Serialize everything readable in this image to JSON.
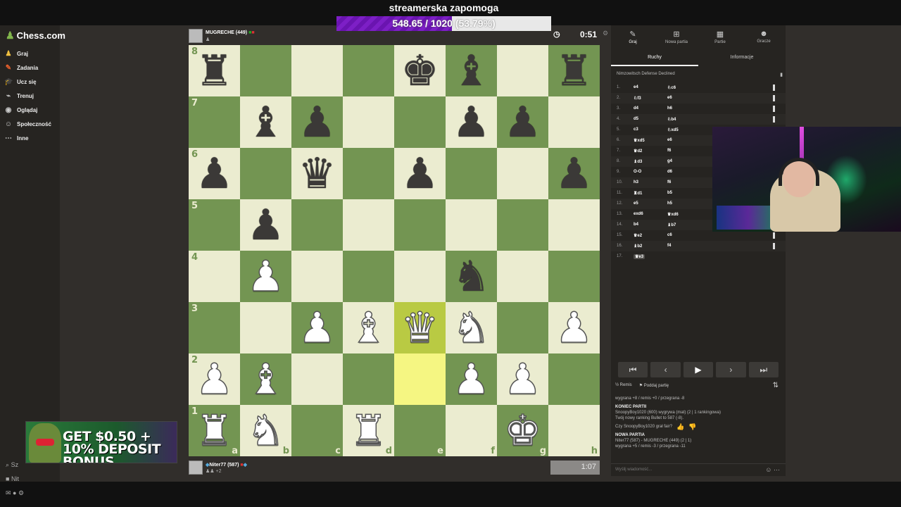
{
  "stream": {
    "title": "streamerska zapomoga",
    "progress_value": "548.65 / 1020",
    "progress_pct_label": "(53.79%)",
    "progress_fraction": 0.5379,
    "progress_color": "#7d1fc6"
  },
  "sidebar": {
    "logo": "Chess.com",
    "items": [
      {
        "label": "Graj",
        "icon": "pawn-play-icon",
        "color": "#f0c040"
      },
      {
        "label": "Zadania",
        "icon": "puzzle-icon",
        "color": "#e8602c"
      },
      {
        "label": "Ucz się",
        "icon": "learn-icon",
        "color": "#3ba0e0"
      },
      {
        "label": "Trenuj",
        "icon": "train-icon",
        "color": "#ccc"
      },
      {
        "label": "Oglądaj",
        "icon": "watch-icon",
        "color": "#ccc"
      },
      {
        "label": "Społeczność",
        "icon": "community-icon",
        "color": "#ccc"
      },
      {
        "label": "Inne",
        "icon": "more-icon",
        "color": "#ccc"
      }
    ],
    "bonus_text": "GET $0.50 + 10% DEPOSIT BONUS",
    "search_prefix": "Sz",
    "user_prefix": "Nit"
  },
  "top_player": {
    "name": "MUGRECHE",
    "rating": "(449)",
    "clock": "0:51"
  },
  "bottom_player": {
    "name": "Niter77",
    "rating": "(587)",
    "diff": "+2",
    "clock": "1:07"
  },
  "board": {
    "rows": [
      [
        "br",
        "",
        "",
        "",
        "bk",
        "bb",
        "",
        "br"
      ],
      [
        "",
        "bb",
        "bp",
        "",
        "",
        "bp",
        "bp",
        ""
      ],
      [
        "bp",
        "",
        "bq",
        "",
        "bp",
        "",
        "",
        "bp"
      ],
      [
        "",
        "bp",
        "",
        "",
        "",
        "",
        "",
        ""
      ],
      [
        "",
        "wp",
        "",
        "",
        "",
        "bn",
        "",
        ""
      ],
      [
        "",
        "",
        "wp",
        "wb",
        "wq",
        "wn",
        "",
        "wp"
      ],
      [
        "wp",
        "wb",
        "",
        "",
        "",
        "wp",
        "wp",
        ""
      ],
      [
        "wr",
        "wn",
        "",
        "wr",
        "",
        "",
        "wk",
        ""
      ]
    ],
    "highlights": [
      "e3",
      "e2"
    ],
    "ranks": [
      "8",
      "7",
      "6",
      "5",
      "4",
      "3",
      "2",
      "1"
    ],
    "files": [
      "a",
      "b",
      "c",
      "d",
      "e",
      "f",
      "g",
      "h"
    ]
  },
  "panel": {
    "tabs": [
      {
        "label": "Graj",
        "icon": "pawn-icon"
      },
      {
        "label": "Nowa partia",
        "icon": "plus-icon"
      },
      {
        "label": "Partie",
        "icon": "board-icon"
      },
      {
        "label": "Gracze",
        "icon": "players-icon"
      }
    ],
    "subtabs": [
      "Ruchy",
      "Informacje"
    ],
    "opening": "Nimzowitsch Defense Declined",
    "moves": [
      {
        "n": "1.",
        "w": "e4",
        "b": "♘c6"
      },
      {
        "n": "2.",
        "w": "♘f3",
        "b": "e6"
      },
      {
        "n": "3.",
        "w": "d4",
        "b": "h6"
      },
      {
        "n": "4.",
        "w": "d5",
        "b": "♘b4"
      },
      {
        "n": "5.",
        "w": "c3",
        "b": "♘xd5"
      },
      {
        "n": "6.",
        "w": "♛xd5",
        "b": "e6"
      },
      {
        "n": "7.",
        "w": "♛d2",
        "b": "f6"
      },
      {
        "n": "8.",
        "w": "♝d3",
        "b": "g4"
      },
      {
        "n": "9.",
        "w": "O-O",
        "b": "d6"
      },
      {
        "n": "10.",
        "w": "h3",
        "b": "f6"
      },
      {
        "n": "11.",
        "w": "♜d1",
        "b": "b5"
      },
      {
        "n": "12.",
        "w": "e5",
        "b": "h5"
      },
      {
        "n": "13.",
        "w": "exd6",
        "b": "♛xd6"
      },
      {
        "n": "14.",
        "w": "b4",
        "b": "♝b7"
      },
      {
        "n": "15.",
        "w": "♛e2",
        "b": "c6"
      },
      {
        "n": "16.",
        "w": "♝b2",
        "b": "f4"
      },
      {
        "n": "17.",
        "w": "♛e3",
        "b": ""
      }
    ],
    "actions": {
      "draw": "Remis",
      "resign": "Poddaj partię"
    },
    "chat": {
      "l1": "wygrana +8 / remis +0 / przegrana -8",
      "h1": "KONIEC PARTII",
      "l2": "SnoopyBoy1020 (600) wygrywa (mat) (2 | 1 rankingowa)",
      "l3": "Twój nowy ranking Bullet to 587 (-8).",
      "q": "Czy SnoopyBoy1020 grał fair?",
      "h2": "NOWA PARTIA",
      "l4": "Niter77 (587) - MUGRECHE (449) (2 | 1)",
      "l5": "wygrana +5 / remis -3 / przegrana -11",
      "input_placeholder": "Wyślij wiadomość..."
    }
  }
}
